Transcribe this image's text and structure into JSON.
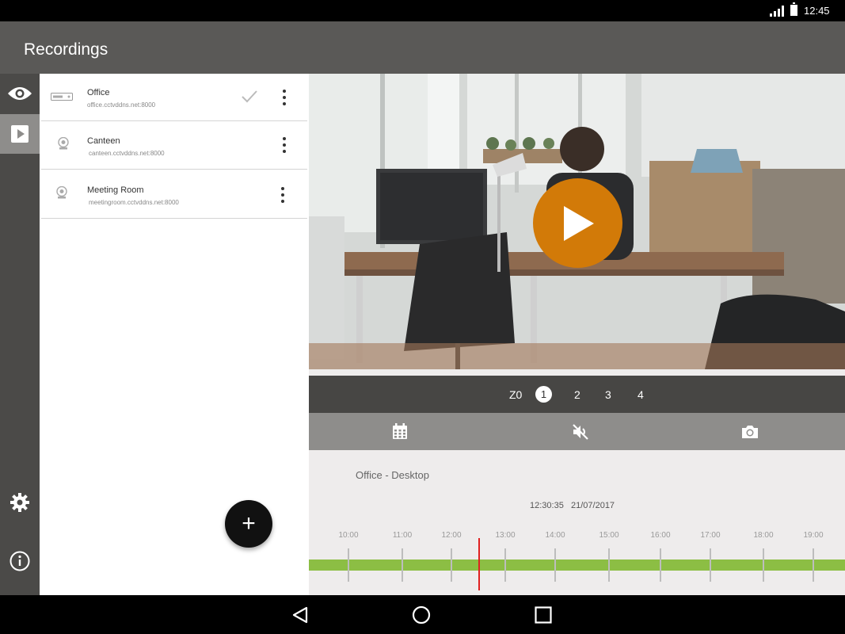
{
  "status_bar": {
    "time": "12:45"
  },
  "app_bar": {
    "title": "Recordings"
  },
  "nav_rail": {
    "items": [
      {
        "icon": "eye-icon",
        "active": false
      },
      {
        "icon": "play-square-icon",
        "active": true
      },
      {
        "icon": "gear-icon",
        "active": false
      },
      {
        "icon": "info-icon",
        "active": false
      }
    ]
  },
  "devices": [
    {
      "name": "Office",
      "address": "office.cctvddns.net:8000",
      "icon": "dvr-icon",
      "selected": true
    },
    {
      "name": "Canteen",
      "address": "canteen.cctvddns.net:8000",
      "icon": "webcam-icon",
      "selected": false
    },
    {
      "name": "Meeting Room",
      "address": "meetingroom.cctvddns.net:8000",
      "icon": "webcam-icon",
      "selected": false
    }
  ],
  "fab": {
    "label": "+"
  },
  "zoom": {
    "levels": [
      "Z0",
      "1",
      "2",
      "3",
      "4"
    ],
    "selected": "1"
  },
  "actions": [
    {
      "icon": "calendar-icon"
    },
    {
      "icon": "mute-icon"
    },
    {
      "icon": "camera-icon"
    }
  ],
  "timeline": {
    "camera_name": "Office - Desktop",
    "time": "12:30:35",
    "date": "21/07/2017",
    "hours": [
      "10:00",
      "11:00",
      "12:00",
      "13:00",
      "14:00",
      "15:00",
      "16:00",
      "17:00",
      "18:00",
      "19:00"
    ]
  },
  "colors": {
    "accent": "#d27a08",
    "recording": "#8cbe44",
    "cursor": "#e02020",
    "app_bar": "#5a5957"
  }
}
